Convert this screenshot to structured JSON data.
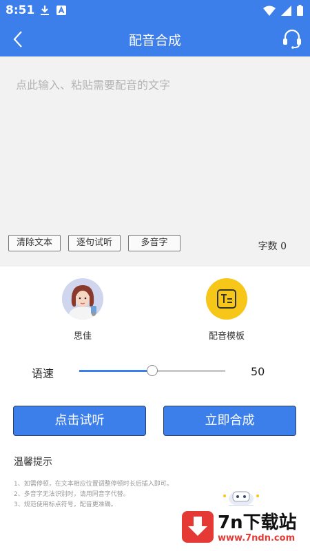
{
  "status_bar": {
    "time": "8:51",
    "left_icons": [
      "download-icon",
      "app-a-icon"
    ],
    "right_icons": [
      "wifi-icon",
      "signal-icon",
      "battery-icon"
    ]
  },
  "app_bar": {
    "title": "配音合成",
    "back_icon": "back-arrow-icon",
    "service_icon": "headset-icon"
  },
  "editor": {
    "placeholder": "点此输入、粘贴需要配音的文字",
    "buttons": {
      "clear": "清除文本",
      "sentence_preview": "逐句试听",
      "polyphone": "多音字"
    },
    "word_count_label": "字数 0"
  },
  "options": {
    "voice": {
      "label": "思佳",
      "icon": "avatar-icon"
    },
    "template": {
      "label": "配音模板",
      "icon": "template-icon"
    }
  },
  "speed": {
    "label": "语速",
    "value": "50",
    "fraction": 0.5
  },
  "actions": {
    "preview": "点击试听",
    "synthesize": "立即合成"
  },
  "tips": {
    "title": "温馨提示",
    "items": [
      "1、如需停顿，在文本相应位置调整停顿时长后插入即可。",
      "2、多音字无法识别时，请用同音字代替。",
      "3、规范使用标点符号，配音更准确。"
    ]
  },
  "watermark": {
    "title": "7n下载站",
    "url": "www.7ndn.com"
  },
  "colors": {
    "primary": "#3d7fea",
    "editor_bg": "#f2f2f2",
    "template_yellow": "#f6c619",
    "watermark_red": "#e53935"
  }
}
